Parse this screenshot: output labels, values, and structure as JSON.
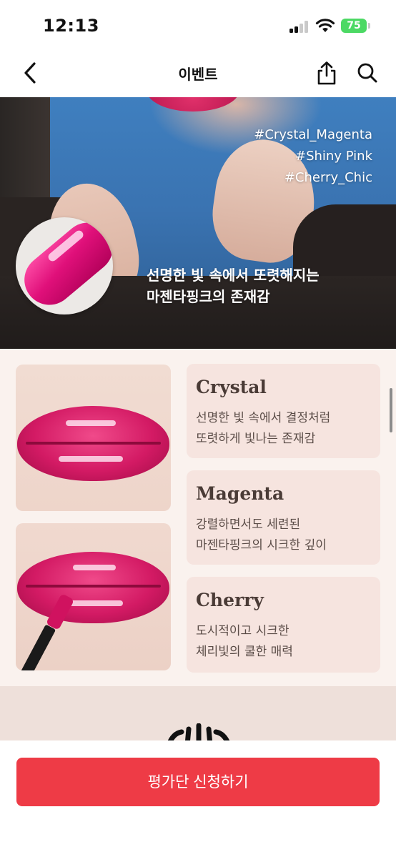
{
  "status_bar": {
    "time": "12:13",
    "battery": "75"
  },
  "nav": {
    "title": "이벤트",
    "icons": [
      "back-chevron-icon",
      "share-icon",
      "search-icon"
    ]
  },
  "hero": {
    "hashtags": [
      "#Crystal_Magenta",
      "#Shiny Pink",
      "#Cherry_Chic"
    ],
    "caption_line1": "선명한 빛 속에서 또렷해지는",
    "caption_line2": "마젠타핑크의 존재감"
  },
  "shades": [
    {
      "name": "Crystal",
      "desc_line1": "선명한 빛 속에서 결정처럼",
      "desc_line2": "또렷하게 빛나는 존재감"
    },
    {
      "name": "Magenta",
      "desc_line1": "강렬하면서도 세련된",
      "desc_line2": "마젠타핑크의 시크한 깊이"
    },
    {
      "name": "Cherry",
      "desc_line1": "도시적이고 시크한",
      "desc_line2": "체리빛의 쿨한 매력"
    }
  ],
  "cta": {
    "label": "평가단 신청하기"
  },
  "colors": {
    "cta": "#ee3b46",
    "card_bg": "#f6e4df",
    "section_bg": "#faf2ee",
    "lip_magenta": "#d31a64"
  }
}
